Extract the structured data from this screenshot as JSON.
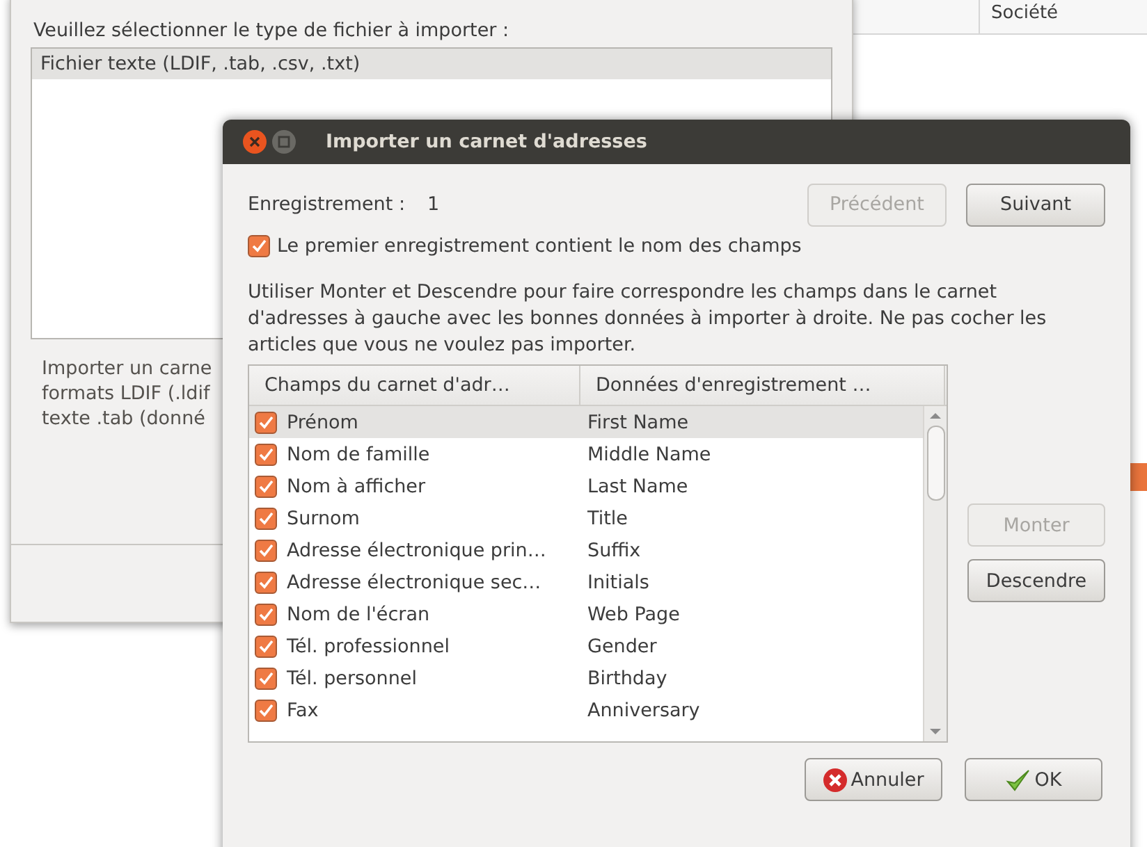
{
  "background_window": {
    "prompt": "Veuillez sélectionner le type de fichier à importer :",
    "file_types": [
      {
        "label": "Fichier texte (LDIF, .tab, .csv, .txt)",
        "selected": true
      }
    ],
    "description_lines": [
      "Importer un carne",
      "formats LDIF (.ldif",
      "texte .tab (donné"
    ]
  },
  "other_window": {
    "columns": [
      "Société"
    ]
  },
  "dialog": {
    "title": "Importer un carnet d'adresses",
    "record_label": "Enregistrement :",
    "record_number": "1",
    "nav_buttons": [
      {
        "label": "Précédent",
        "disabled": true
      },
      {
        "label": "Suivant",
        "disabled": false
      }
    ],
    "first_record_option": {
      "label": "Le premier enregistrement contient le nom des champs",
      "checked": true
    },
    "instructions": "Utiliser Monter et Descendre pour faire correspondre les champs dans le carnet d'adresses à gauche avec les bonnes données à importer à droite. Ne pas cocher les articles que vous ne voulez pas importer.",
    "table": {
      "columns": [
        "Champs du carnet d'adr…",
        "Données d'enregistrement …"
      ],
      "rows": [
        {
          "field": "Prénom",
          "data": "First Name",
          "checked": true,
          "selected": true
        },
        {
          "field": "Nom de famille",
          "data": "Middle Name",
          "checked": true,
          "selected": false
        },
        {
          "field": "Nom à afficher",
          "data": "Last Name",
          "checked": true,
          "selected": false
        },
        {
          "field": "Surnom",
          "data": "Title",
          "checked": true,
          "selected": false
        },
        {
          "field": "Adresse électronique prin…",
          "data": "Suffix",
          "checked": true,
          "selected": false
        },
        {
          "field": "Adresse électronique sec…",
          "data": "Initials",
          "checked": true,
          "selected": false
        },
        {
          "field": "Nom de l'écran",
          "data": "Web Page",
          "checked": true,
          "selected": false
        },
        {
          "field": "Tél. professionnel",
          "data": "Gender",
          "checked": true,
          "selected": false
        },
        {
          "field": "Tél. personnel",
          "data": "Birthday",
          "checked": true,
          "selected": false
        },
        {
          "field": "Fax",
          "data": "Anniversary",
          "checked": true,
          "selected": false
        }
      ]
    },
    "side_buttons": [
      {
        "label": "Monter",
        "disabled": true
      },
      {
        "label": "Descendre",
        "disabled": false
      }
    ],
    "footer_buttons": [
      {
        "label": "Annuler",
        "kind": "cancel"
      },
      {
        "label": "OK",
        "kind": "ok"
      }
    ]
  }
}
